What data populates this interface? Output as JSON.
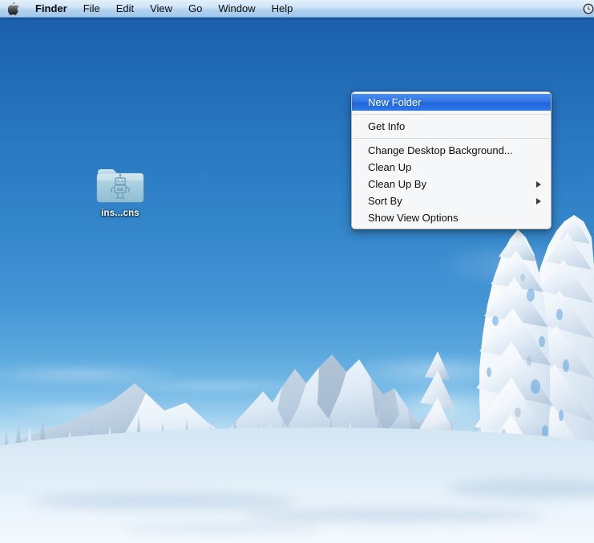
{
  "menubar": {
    "apple_icon": "apple-logo-icon",
    "items": [
      {
        "label": "Finder",
        "bold": true
      },
      {
        "label": "File",
        "bold": false
      },
      {
        "label": "Edit",
        "bold": false
      },
      {
        "label": "View",
        "bold": false
      },
      {
        "label": "Go",
        "bold": false
      },
      {
        "label": "Window",
        "bold": false
      },
      {
        "label": "Help",
        "bold": false
      }
    ],
    "status_icon": "clock-icon"
  },
  "desktop": {
    "wallpaper_description": "snowy mountain landscape with frosted trees under blue sky",
    "icons": [
      {
        "label": "ins...cns",
        "icon": "automator-robot-folder-icon"
      }
    ]
  },
  "context_menu": {
    "items": [
      {
        "label": "New Folder",
        "highlighted": true,
        "submenu": false,
        "separator_after": true
      },
      {
        "label": "Get Info",
        "highlighted": false,
        "submenu": false,
        "separator_after": true
      },
      {
        "label": "Change Desktop Background...",
        "highlighted": false,
        "submenu": false,
        "separator_after": false
      },
      {
        "label": "Clean Up",
        "highlighted": false,
        "submenu": false,
        "separator_after": false
      },
      {
        "label": "Clean Up By",
        "highlighted": false,
        "submenu": true,
        "separator_after": false
      },
      {
        "label": "Sort By",
        "highlighted": false,
        "submenu": true,
        "separator_after": false
      },
      {
        "label": "Show View Options",
        "highlighted": false,
        "submenu": false,
        "separator_after": false
      }
    ]
  },
  "colors": {
    "menubar_top": "#e4f0fb",
    "menubar_bottom": "#9fc7ea",
    "highlight_blue": "#2f74e6",
    "menu_background": "#f6f7f9",
    "sky_top": "#1a5ba6",
    "sky_bottom": "#c4e2f4",
    "folder_blue": "#a9cfe0",
    "snow_white": "#f4f9fd"
  }
}
